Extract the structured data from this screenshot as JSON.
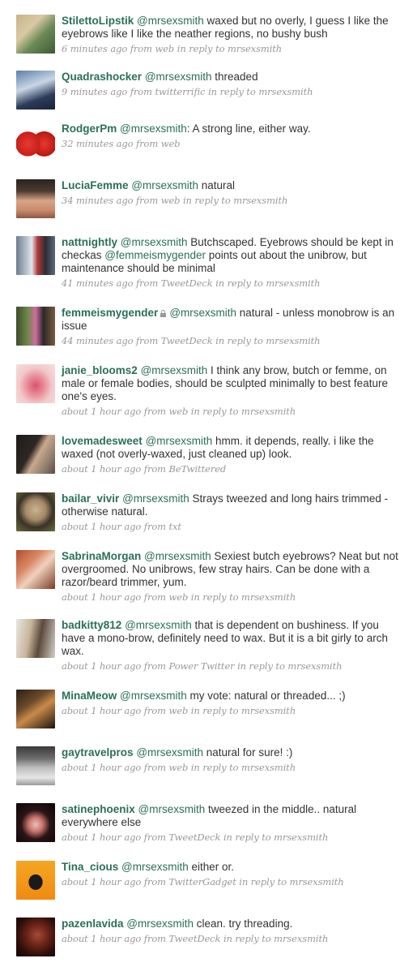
{
  "colors": {
    "link": "#2a6f5b",
    "text": "#333333",
    "meta": "#999999"
  },
  "tweets": [
    {
      "user": "StilettoLipstik",
      "mention": "@mrsexsmith",
      "text": " waxed but no overly, I guess I like the eyebrows like I like the neather regions, no bushy bush",
      "meta": "6 minutes ago from web in reply to mrsexsmith"
    },
    {
      "user": "Quadrashocker",
      "mention": "@mrsexsmith",
      "text": " threaded",
      "meta": "9 minutes ago from twitterrific in reply to mrsexsmith"
    },
    {
      "user": "RodgerPm",
      "mention": "@mrsexsmith",
      "text": ": A strong line, either way.",
      "meta": "32 minutes ago from web"
    },
    {
      "user": "LuciaFemme",
      "mention": "@mrsexsmith",
      "text": " natural",
      "meta": "34 minutes ago from web in reply to mrsexsmith"
    },
    {
      "user": "nattnightly",
      "mention": "@mrsexsmith",
      "text_a": " Butchscaped. Eyebrows should be kept in checkas ",
      "mention2": "@femmeismygender",
      "text_b": " points out about the unibrow, but maintenance should be minimal",
      "meta": "41 minutes ago from TweetDeck in reply to mrsexsmith"
    },
    {
      "user": "femmeismygender",
      "lock_icon": "lock-icon",
      "mention": "@mrsexsmith",
      "text": " natural - unless monobrow is an issue",
      "meta": "44 minutes ago from TweetDeck in reply to mrsexsmith"
    },
    {
      "user": "janie_blooms2",
      "mention": "@mrsexsmith",
      "text": " I think any brow, butch or femme, on male or female bodies, should be sculpted minimally to best feature one's eyes.",
      "meta": "about 1 hour ago from web in reply to mrsexsmith"
    },
    {
      "user": "lovemadesweet",
      "mention": "@mrsexsmith",
      "text": " hmm. it depends, really. i like the waxed (not overly-waxed, just cleaned up) look.",
      "meta": "about 1 hour ago from BeTwittered"
    },
    {
      "user": "bailar_vivir",
      "mention": "@mrsexsmith",
      "text": " Strays tweezed and long hairs trimmed - otherwise natural.",
      "meta": "about 1 hour ago from txt"
    },
    {
      "user": "SabrinaMorgan",
      "mention": "@mrsexsmith",
      "text": " Sexiest butch eyebrows? Neat but not overgroomed. No unibrows, few stray hairs. Can be done with a razor/beard trimmer, yum.",
      "meta": "about 1 hour ago from web in reply to mrsexsmith"
    },
    {
      "user": "badkitty812",
      "mention": "@mrsexsmith",
      "text": " that is dependent on bushiness. If you have a mono-brow, definitely need to wax. But it is a bit girly to arch wax.",
      "meta": "about 1 hour ago from Power Twitter in reply to mrsexsmith"
    },
    {
      "user": "MinaMeow",
      "mention": "@mrsexsmith",
      "text": " my vote: natural or threaded... ;)",
      "meta": "about 1 hour ago from web in reply to mrsexsmith"
    },
    {
      "user": "gaytravelpros",
      "mention": "@mrsexsmith",
      "text": " natural for sure! :)",
      "meta": "about 1 hour ago from web in reply to mrsexsmith"
    },
    {
      "user": "satinephoenix",
      "mention": "@mrsexsmith",
      "text": " tweezed in the middle.. natural everywhere else",
      "meta": "about 1 hour ago from TweetDeck in reply to mrsexsmith"
    },
    {
      "user": "Tina_cious",
      "mention": "@mrsexsmith",
      "text": " either or.",
      "meta": "about 1 hour ago from TwitterGadget in reply to mrsexsmith"
    },
    {
      "user": "pazenlavida",
      "mention": "@mrsexsmith",
      "text": " clean. try threading.",
      "meta": "about 1 hour ago from TweetDeck in reply to mrsexsmith"
    }
  ]
}
